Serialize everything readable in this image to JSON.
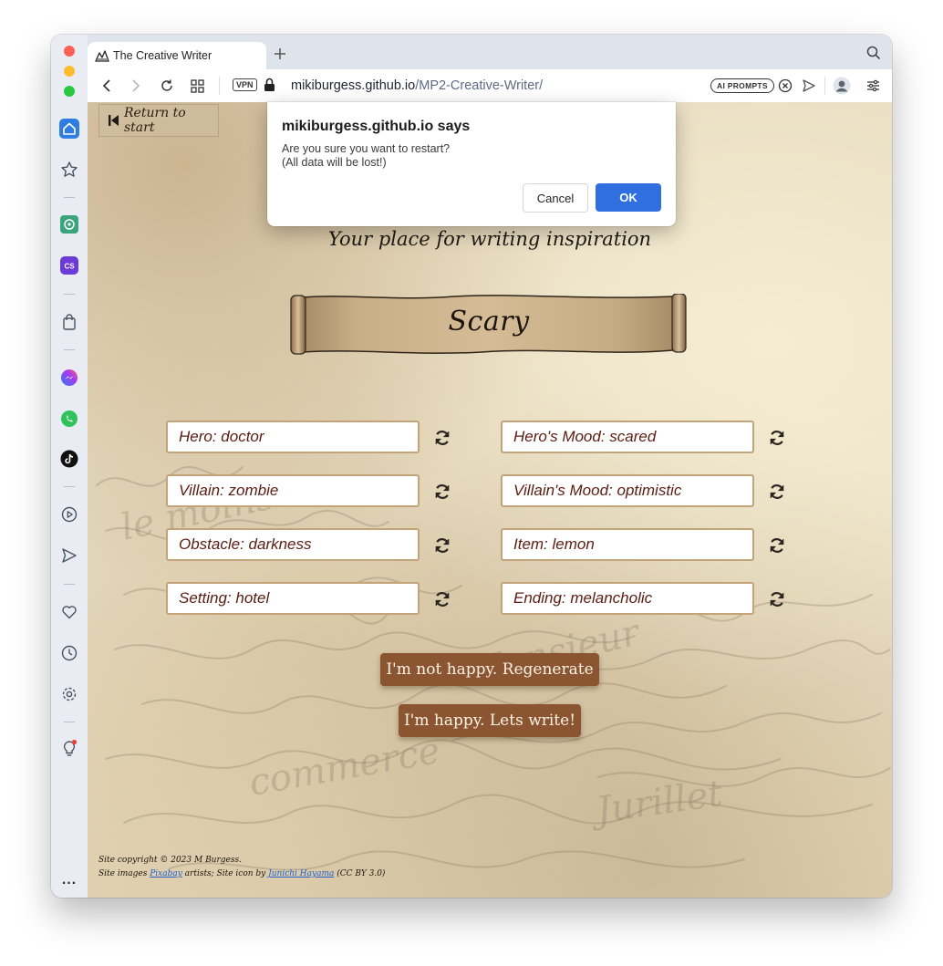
{
  "browser": {
    "tab_title": "The Creative Writer",
    "url_domain": "mikiburgess.github.io",
    "url_path": "/MP2-Creative-Writer/",
    "vpn_label": "VPN",
    "ai_prompts_label": "AI PROMPTS"
  },
  "sidebar": {
    "items": [
      "home-icon",
      "star-icon",
      "chatgpt-icon",
      "cs-icon",
      "shopping-bag-icon",
      "messenger-icon",
      "whatsapp-icon",
      "tiktok-icon",
      "play-icon",
      "send-icon",
      "heart-icon",
      "clock-icon",
      "gear-icon",
      "lightbulb-icon",
      "more-icon"
    ],
    "cs_label": "CS",
    "more_label": "..."
  },
  "page": {
    "back_label": "Return to start",
    "tagline": "Your place for writing inspiration",
    "genre": "Scary",
    "fields": {
      "hero": "Hero: doctor",
      "hero_mood": "Hero's Mood: scared",
      "villain": "Villain: zombie",
      "villain_mood": "Villain's Mood: optimistic",
      "obstacle": "Obstacle: darkness",
      "item": "Item: lemon",
      "setting": "Setting: hotel",
      "ending": "Ending: melancholic"
    },
    "regenerate_label": "I'm not happy. Regenerate",
    "write_label": "I'm happy. Lets write!",
    "footer": {
      "copyright": "Site copyright © 2023 M Burgess.",
      "images_prefix": "Site images ",
      "pixabay": "Pixabay",
      "images_mid": " artists; Site icon by ",
      "icon_author": "Junichi Hayama",
      "license": " (CC BY 3.0)"
    }
  },
  "dialog": {
    "title": "mikiburgess.github.io says",
    "message_line1": "Are you sure you want to restart?",
    "message_line2": "(All data will be lost!)",
    "cancel_label": "Cancel",
    "ok_label": "OK"
  },
  "colors": {
    "accent_blue": "#2f6fe0",
    "button_brown": "#8b5532",
    "field_text": "#5b1d12",
    "field_border": "#c2a37a"
  }
}
